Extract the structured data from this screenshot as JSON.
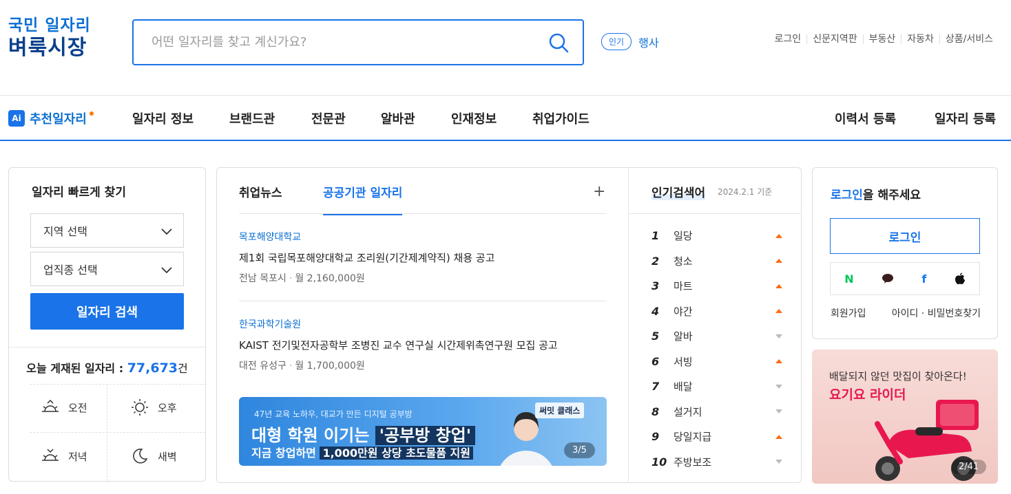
{
  "header": {
    "logo_line1": "국민 일자리",
    "logo_line2": "벼룩시장",
    "search_placeholder": "어떤 일자리를 찾고 계신가요?",
    "popular_pill": "인기",
    "popular_term": "행사",
    "top_links": [
      "로그인",
      "신문지역판",
      "부동산",
      "자동차",
      "상품/서비스"
    ]
  },
  "nav": {
    "ai_badge": "Ai",
    "ai_label": "추천일자리",
    "items": [
      "일자리 정보",
      "브랜드관",
      "전문관",
      "알바관",
      "인재정보",
      "취업가이드"
    ],
    "right_items": [
      "이력서 등록",
      "일자리 등록"
    ]
  },
  "quick_find": {
    "title": "일자리 빠르게 찾기",
    "region_select": "지역 선택",
    "job_select": "업직종 선택",
    "search_button": "일자리 검색",
    "today_label": "오늘 게재된 일자리 :",
    "today_count": "77,673",
    "today_unit": "건",
    "times": [
      "오전",
      "오후",
      "저녁",
      "새벽"
    ]
  },
  "news": {
    "tabs": [
      "취업뉴스",
      "공공기관 일자리"
    ],
    "plus": "+",
    "jobs": [
      {
        "org": "목포해양대학교",
        "title": "제1회 국립목포해양대학교 조리원(기간제계약직) 채용 공고",
        "location": "전남 목포시",
        "salary": "월 2,160,000원"
      },
      {
        "org": "한국과학기술원",
        "title": "KAIST 전기및전자공학부 조병진 교수 연구실 시간제위촉연구원 모집 공고",
        "location": "대전 유성구",
        "salary": "월 1,700,000원"
      }
    ],
    "banner": {
      "line1": "47년 교육 노하우, 대교가 만든 디지털 공부방",
      "line2a": "대형 학원 이기는",
      "line2b": "'공부방 창업'",
      "line3a": "지금 창업하면",
      "line3b": "1,000만원 상당 초도물품 지원",
      "brand": "써밋 클래스",
      "pager": "3/5"
    }
  },
  "popular": {
    "title": "인기검색어",
    "date": "2024.2.1 기준",
    "ranks": [
      {
        "n": "1",
        "word": "일당",
        "trend": "up"
      },
      {
        "n": "2",
        "word": "청소",
        "trend": "up"
      },
      {
        "n": "3",
        "word": "마트",
        "trend": "up"
      },
      {
        "n": "4",
        "word": "야간",
        "trend": "up"
      },
      {
        "n": "5",
        "word": "알바",
        "trend": "down"
      },
      {
        "n": "6",
        "word": "서빙",
        "trend": "up"
      },
      {
        "n": "7",
        "word": "배달",
        "trend": "down"
      },
      {
        "n": "8",
        "word": "설거지",
        "trend": "down"
      },
      {
        "n": "9",
        "word": "당일지급",
        "trend": "up"
      },
      {
        "n": "10",
        "word": "주방보조",
        "trend": "down"
      }
    ]
  },
  "login": {
    "title_accent": "로그인",
    "title_rest": "을 해주세요",
    "button": "로그인",
    "social": [
      "naver-icon",
      "kakao-icon",
      "facebook-icon",
      "apple-icon"
    ],
    "signup": "회원가입",
    "find": "아이디 · 비밀번호찾기"
  },
  "ad": {
    "line1": "배달되지 않던 맛집이 찾아온다!",
    "line2": "요기요 라이더",
    "pager": "2/41"
  }
}
